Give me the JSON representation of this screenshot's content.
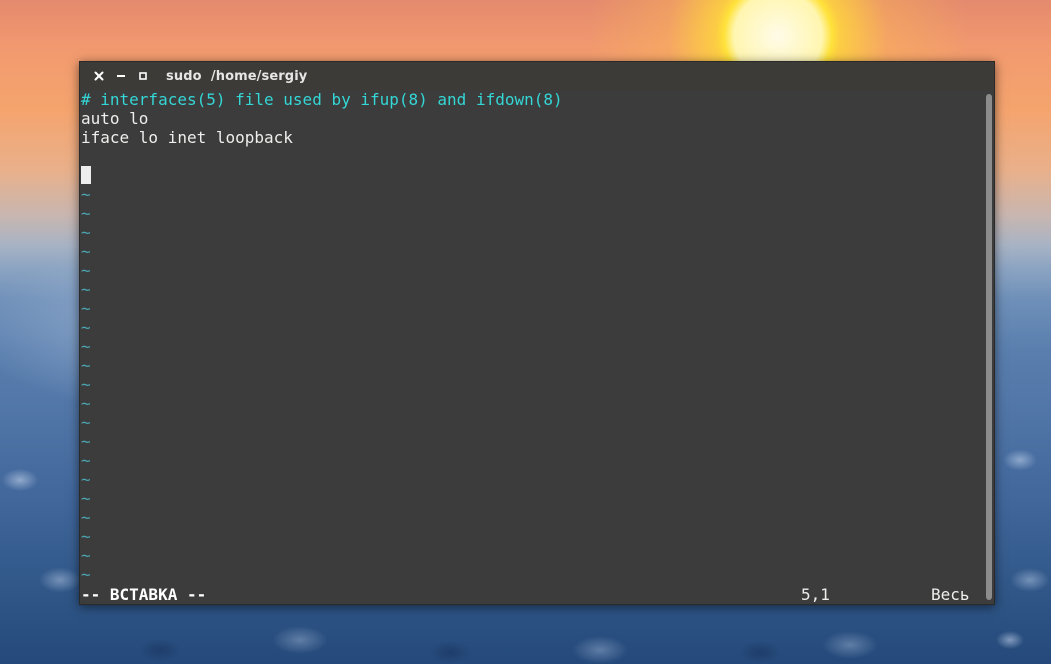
{
  "window": {
    "title": "sudo  /home/sergiy",
    "buttons": {
      "close_icon": "close-icon",
      "minimize_icon": "minimize-icon",
      "maximize_icon": "maximize-icon"
    }
  },
  "editor": {
    "lines": [
      "# interfaces(5) file used by ifup(8) and ifdown(8)",
      "auto lo",
      "iface lo inet loopback",
      "",
      ""
    ],
    "empty_line_marker": "~",
    "empty_line_count": 21
  },
  "statusbar": {
    "mode": "-- ВСТАВКА --",
    "cursor_position": "5,1",
    "scroll_position": "Весь"
  },
  "colors": {
    "comment": "#34d6d6",
    "tilde": "#4aa7b3",
    "text": "#eeeeec",
    "background": "#3c3c3c",
    "titlebar": "#3c3b37"
  }
}
